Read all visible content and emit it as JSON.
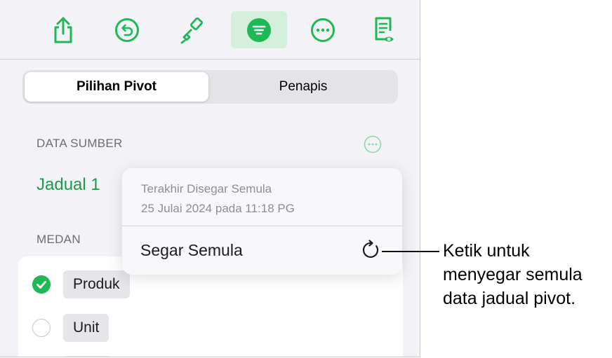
{
  "toolbar": {
    "buttons": [
      {
        "icon": "share-icon"
      },
      {
        "icon": "undo-icon"
      },
      {
        "icon": "paintbrush-icon"
      },
      {
        "icon": "organize-icon",
        "active": true
      },
      {
        "icon": "more-icon"
      },
      {
        "icon": "document-view-icon"
      }
    ],
    "accent": "#1db954"
  },
  "segmented": {
    "options": [
      "Pilihan Pivot",
      "Penapis"
    ],
    "selected": "Pilihan Pivot"
  },
  "source": {
    "section_label": "DATA SUMBER",
    "table_name": "Jadual 1"
  },
  "fields": {
    "section_label": "MEDAN",
    "items": [
      {
        "label": "Produk",
        "checked": true
      },
      {
        "label": "Unit",
        "checked": false
      }
    ]
  },
  "popover": {
    "last_refreshed_label": "Terakhir Disegar Semula",
    "last_refreshed_date": "25 Julai 2024 pada 11:18 PG",
    "action_label": "Segar Semula"
  },
  "callout": {
    "lines": [
      "Ketik untuk",
      "menyegar semula",
      "data jadual pivot."
    ]
  }
}
